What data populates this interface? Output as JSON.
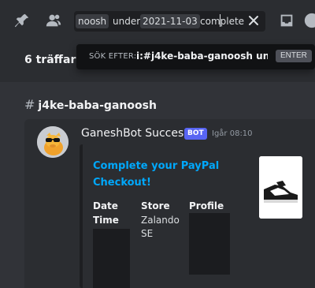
{
  "search": {
    "query_token": "noosh",
    "filter_label": "under:",
    "filter_value": "2021-11-03",
    "typed_text": "complete"
  },
  "results": {
    "count_label": "6 träffar"
  },
  "autocomplete": {
    "label": "SÖK EFTER:",
    "value": "i:#j4ke-baba-ganoosh un...",
    "key_hint": "ENTER"
  },
  "channel": {
    "name": "j4ke-baba-ganoosh"
  },
  "message": {
    "author": "GaneshBot Success",
    "bot_badge": "BOT",
    "timestamp": "Igår 08:10",
    "embed": {
      "title": "Complete your PayPal Checkout!",
      "fields": [
        {
          "name": "Date Time",
          "value": ""
        },
        {
          "name": "Store",
          "value": "Zalando SE"
        },
        {
          "name": "Profile",
          "value": ""
        }
      ]
    }
  },
  "colors": {
    "background": "#313338",
    "accent_link": "#00a8fc",
    "bot_badge": "#5865f2"
  }
}
